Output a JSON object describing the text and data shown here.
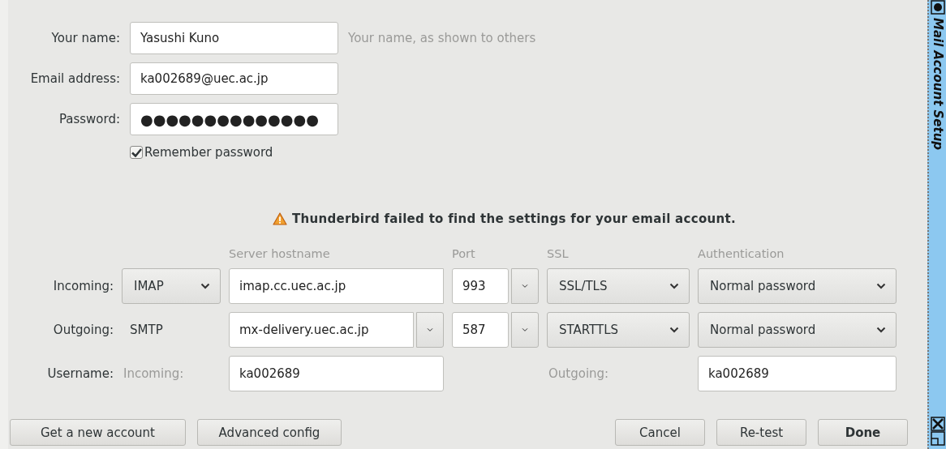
{
  "identity": {
    "name": {
      "label": "Your name:",
      "value": "Yasushi Kuno",
      "hint": "Your name, as shown to others"
    },
    "email": {
      "label": "Email address:",
      "value": "ka002689@uec.ac.jp"
    },
    "password": {
      "label": "Password:",
      "value": "●●●●●●●●●●●●●●"
    },
    "remember": {
      "label": "Remember password",
      "checked": true
    }
  },
  "warning": "Thunderbird failed to find the settings for your email account.",
  "server": {
    "columns": [
      "Server hostname",
      "Port",
      "SSL",
      "Authentication"
    ],
    "rows": [
      {
        "label": "Incoming:",
        "protocol": {
          "kind": "select",
          "value": "IMAP"
        },
        "hostname": "imap.cc.uec.ac.jp",
        "hostname_menu": false,
        "port": "993",
        "ssl": "SSL/TLS",
        "auth": "Normal password"
      },
      {
        "label": "Outgoing:",
        "protocol": {
          "kind": "static",
          "value": "SMTP"
        },
        "hostname": "mx-delivery.uec.ac.jp",
        "hostname_menu": true,
        "port": "587",
        "ssl": "STARTTLS",
        "auth": "Normal password"
      }
    ],
    "username": {
      "label": "Username:",
      "incoming_label": "Incoming:",
      "incoming_value": "ka002689",
      "outgoing_label": "Outgoing:",
      "outgoing_value": "ka002689"
    }
  },
  "left_buttons": [
    {
      "label": "Get a new account",
      "default": false
    },
    {
      "label": "Advanced config",
      "default": false
    }
  ],
  "right_buttons": [
    {
      "label": "Cancel",
      "default": false
    },
    {
      "label": "Re-test",
      "default": false
    },
    {
      "label": "Done",
      "default": true
    }
  ],
  "title_bar": {
    "title": "Mail Account Setup"
  }
}
